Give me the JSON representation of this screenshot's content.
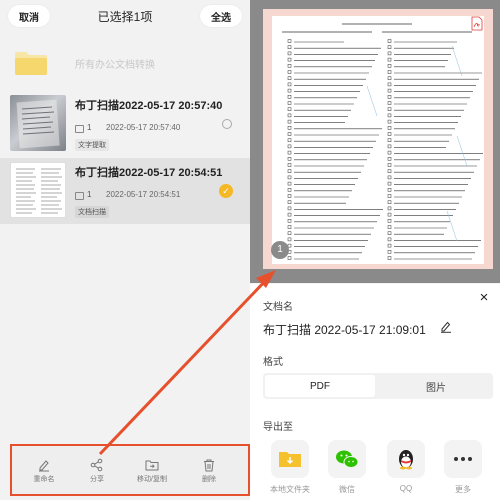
{
  "header": {
    "cancel_label": "取消",
    "title": "已选择1项",
    "select_all_label": "全选"
  },
  "folder": {
    "label": "所有办公文档转换"
  },
  "documents": [
    {
      "title": "布丁扫描2022-05-17 20:57:40",
      "pages": "1",
      "date": "2022-05-17 20:57:40",
      "tag": "文字提取",
      "selected": false
    },
    {
      "title": "布丁扫描2022-05-17 20:54:51",
      "pages": "1",
      "date": "2022-05-17 20:54:51",
      "tag": "文档扫描",
      "selected": true
    }
  ],
  "toolbar": {
    "rename_label": "重命名",
    "share_label": "分享",
    "move_copy_label": "移动/复制",
    "delete_label": "删除"
  },
  "preview": {
    "page_number": "1"
  },
  "sheet": {
    "doc_name_label": "文档名",
    "doc_name_value": "布丁扫描 2022-05-17 21:09:01",
    "format_label": "格式",
    "format_options": [
      "PDF",
      "图片"
    ],
    "selected_format": "PDF",
    "export_label": "导出至",
    "export_targets": [
      "本地文件夹",
      "微信",
      "QQ",
      "更多"
    ]
  },
  "colors": {
    "accent": "#f5b826",
    "highlight_box": "#e6502c",
    "folder": "#f5d76e",
    "wechat": "#2dc100",
    "pdf_red": "#e53935"
  }
}
